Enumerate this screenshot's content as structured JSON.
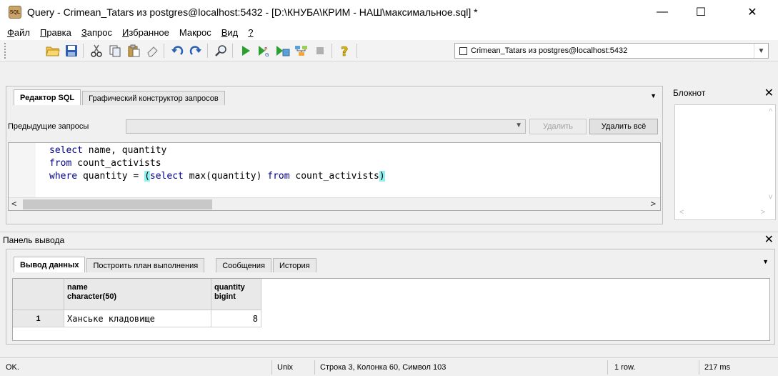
{
  "window": {
    "title": "Query - Crimean_Tatars из postgres@localhost:5432 - [D:\\КНУБА\\КРИМ - НАШ\\максимальное.sql] *",
    "app_icon_text": "SQL",
    "minimize": "—",
    "maximize": "☐",
    "close": "✕"
  },
  "menu": {
    "items": [
      {
        "u": "Ф",
        "rest": "айл"
      },
      {
        "u": "П",
        "rest": "равка"
      },
      {
        "u": "З",
        "rest": "апрос"
      },
      {
        "u": "И",
        "rest": "збранное"
      },
      {
        "u": "",
        "rest": "Макрос"
      },
      {
        "u": "В",
        "rest": "ид"
      },
      {
        "u": "?",
        "rest": ""
      }
    ]
  },
  "toolbar": {
    "connection": "Crimean_Tatars из postgres@localhost:5432"
  },
  "editor": {
    "tabs": [
      "Редактор SQL",
      "Графический конструктор запросов"
    ],
    "prev_label": "Предыдущие запросы",
    "delete_label": "Удалить",
    "delete_all_label": "Удалить всё",
    "code": {
      "line1_kw1": "select",
      "line1_rest": " name, quantity",
      "line2_kw": "from",
      "line2_rest": " count_activists",
      "line3_kw": "where",
      "line3_mid": " quantity = ",
      "line3_open": "(",
      "line3_kw2": "select",
      "line3_mid2": " max(quantity) ",
      "line3_kw3": "from",
      "line3_tail": " count_activists",
      "line3_close": ")"
    }
  },
  "notepad": {
    "title": "Блокнот"
  },
  "output": {
    "title": "Панель вывода",
    "tabs": [
      "Вывод данных",
      "Построить план выполнения",
      "Сообщения",
      "История"
    ],
    "columns": [
      {
        "name": "name",
        "type": "character(50)"
      },
      {
        "name": "quantity",
        "type": "bigint"
      }
    ],
    "rows": [
      {
        "num": "1",
        "name": "Ханське кладовище",
        "quantity": "8"
      }
    ]
  },
  "status": {
    "state": "OK.",
    "eol": "Unix",
    "position": "Строка 3, Колонка 60, Символ 103",
    "rows": "1 row.",
    "time": "217 ms"
  }
}
